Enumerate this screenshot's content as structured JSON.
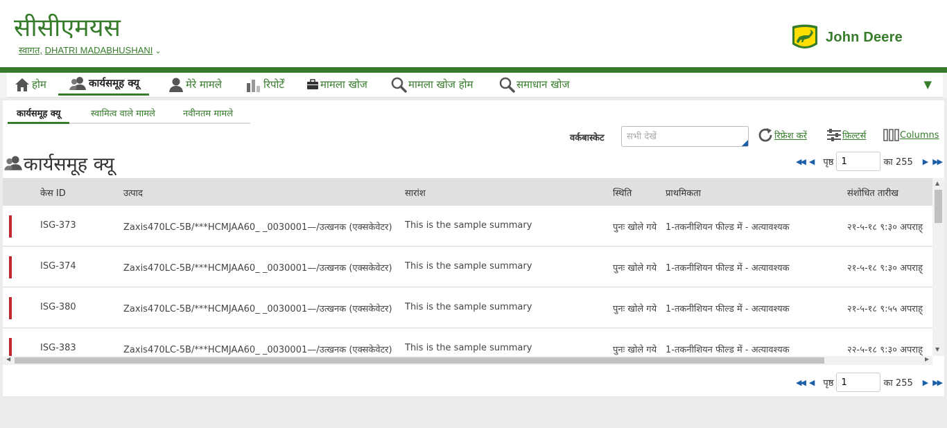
{
  "header": {
    "app_title": "सीसीएमयस",
    "welcome_prefix": "स्वागत,",
    "user_name": "DHATRI MADABHUSHANI",
    "logo_text": "John Deere"
  },
  "nav": {
    "items": [
      {
        "label": "होम",
        "icon": "home-icon"
      },
      {
        "label": "कार्यसमूह क्यू",
        "icon": "group-icon"
      },
      {
        "label": "मेरे मामले",
        "icon": "person-icon"
      },
      {
        "label": "रिपोर्टें",
        "icon": "bar-chart-icon"
      },
      {
        "label": "मामला खोज",
        "icon": "briefcase-icon"
      },
      {
        "label": "मामला खोज होम",
        "icon": "search-icon"
      },
      {
        "label": "समाधान खोज",
        "icon": "search-icon"
      }
    ],
    "more": "▼"
  },
  "subtabs": [
    "कार्यसमूह क्यू",
    "स्वामित्व वाले मामले",
    "नवीनतम मामले"
  ],
  "toolbar": {
    "workbasket_label": "वर्कबास्केट",
    "workbasket_placeholder": "सभी देखें",
    "refresh_label": "रिफ्रेश करें",
    "filters_label": "फ़िल्टर्स",
    "columns_label": "Columns"
  },
  "page_title": "कार्यसमूह क्यू",
  "pager": {
    "page_label": "पृष्ठ",
    "page_value": "1",
    "of_label": "का 255"
  },
  "grid": {
    "columns": [
      "केस ID",
      "उत्पाद",
      "सारांश",
      "स्थिति",
      "प्राथमिकता",
      "संशोधित तारीख"
    ],
    "rows": [
      {
        "id": "ISG-373",
        "product": "Zaxis470LC-5B/***HCMJAA60_ _0030001—/उत्खनक (एक्सकेवेटर)",
        "summary": "This is the sample summary",
        "status": "पुनः खोले गये",
        "priority": "1-तकनीशियन फील्ड में - अत्यावश्यक",
        "date": "२१-५-१८ ९:३० अपराह्"
      },
      {
        "id": "ISG-374",
        "product": "Zaxis470LC-5B/***HCMJAA60_ _0030001—/उत्खनक (एक्सकेवेटर)",
        "summary": "This is the sample summary",
        "status": "पुनः खोले गये",
        "priority": "1-तकनीशियन फील्ड में - अत्यावश्यक",
        "date": "२१-५-१८ ९:३० अपराह्"
      },
      {
        "id": "ISG-380",
        "product": "Zaxis470LC-5B/***HCMJAA60_ _0030001—/उत्खनक (एक्सकेवेटर)",
        "summary": "This is the sample summary",
        "status": "पुनः खोले गये",
        "priority": "1-तकनीशियन फील्ड में - अत्यावश्यक",
        "date": "२१-५-१८ ९:५५ अपराह्"
      },
      {
        "id": "ISG-383",
        "product": "Zaxis470LC-5B/***HCMJAA60_ _0030001—/उत्खनक (एक्सकेवेटर)",
        "summary": "This is the sample summary",
        "status": "पुनः खोले गये",
        "priority": "1-तकनीशियन फील्ड में - अत्यावश्यक",
        "date": "२२-५-१८ ९:३० अपराह्"
      }
    ]
  },
  "colors": {
    "brand_green": "#367c2b",
    "flag_red": "#c0282d",
    "pager_blue": "#1a5fa8"
  }
}
